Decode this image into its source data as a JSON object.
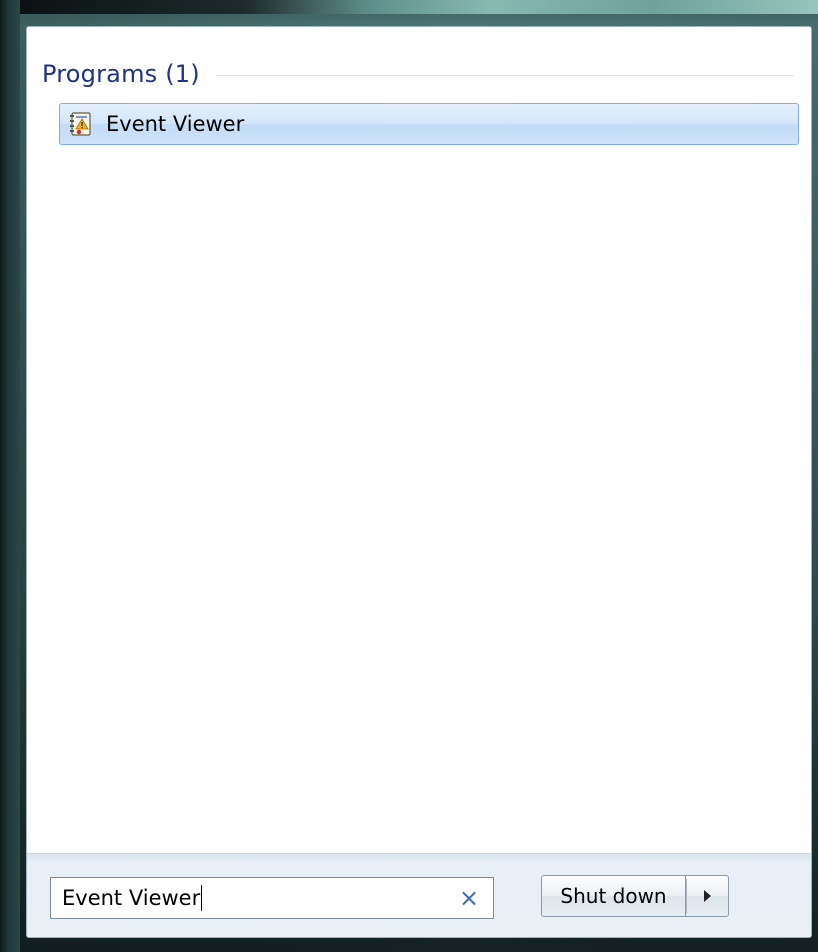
{
  "results": {
    "group_title": "Programs (1)",
    "items": [
      {
        "label": "Event Viewer",
        "icon": "event-viewer-icon"
      }
    ]
  },
  "search": {
    "value": "Event Viewer",
    "clear_glyph": "×"
  },
  "power": {
    "shutdown_label": "Shut down",
    "options_icon": "right-triangle-icon"
  },
  "colors": {
    "group_title": "#1e3287",
    "selected_item_bg": "#d3e6fb",
    "selected_item_border": "#84acdd",
    "clear_icon": "#3c6ab0"
  }
}
